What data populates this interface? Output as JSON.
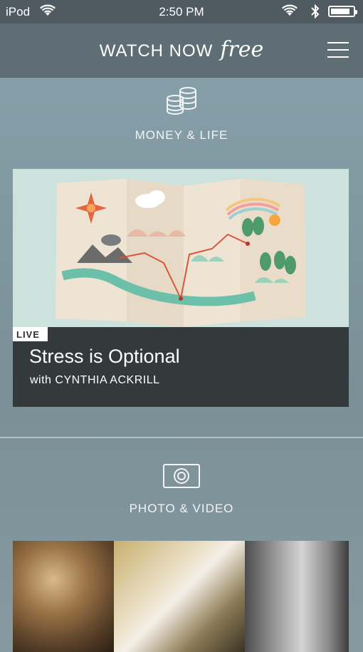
{
  "status_bar": {
    "carrier": "iPod",
    "time": "2:50 PM",
    "battery_level": 0.85
  },
  "header": {
    "logo_text": "WATCH NOW",
    "logo_script": "free"
  },
  "categories": [
    {
      "label": "MONEY & LIFE",
      "icon": "coins-icon"
    },
    {
      "label": "PHOTO & VIDEO",
      "icon": "camera-icon"
    }
  ],
  "featured_course": {
    "badge": "LIVE",
    "title": "Stress is Optional",
    "instructor": "with CYNTHIA ACKRILL"
  },
  "colors": {
    "status_bar_bg": "#4f5b61",
    "header_bg": "#5f6e75",
    "caption_bg": "#34393c",
    "page_bg": "#7f979f"
  }
}
